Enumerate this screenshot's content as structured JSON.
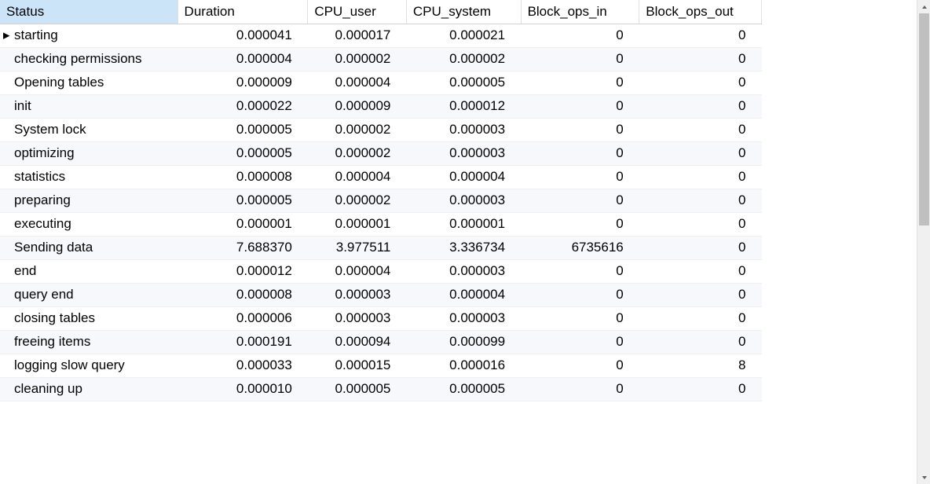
{
  "table": {
    "columns": [
      {
        "key": "status",
        "label": "Status"
      },
      {
        "key": "duration",
        "label": "Duration"
      },
      {
        "key": "cpu_user",
        "label": "CPU_user"
      },
      {
        "key": "cpu_system",
        "label": "CPU_system"
      },
      {
        "key": "block_ops_in",
        "label": "Block_ops_in"
      },
      {
        "key": "block_ops_out",
        "label": "Block_ops_out"
      }
    ],
    "selected_column_index": 0,
    "current_row_index": 0,
    "rows": [
      {
        "status": "starting",
        "duration": "0.000041",
        "cpu_user": "0.000017",
        "cpu_system": "0.000021",
        "block_ops_in": "0",
        "block_ops_out": "0"
      },
      {
        "status": "checking permissions",
        "duration": "0.000004",
        "cpu_user": "0.000002",
        "cpu_system": "0.000002",
        "block_ops_in": "0",
        "block_ops_out": "0"
      },
      {
        "status": "Opening tables",
        "duration": "0.000009",
        "cpu_user": "0.000004",
        "cpu_system": "0.000005",
        "block_ops_in": "0",
        "block_ops_out": "0"
      },
      {
        "status": "init",
        "duration": "0.000022",
        "cpu_user": "0.000009",
        "cpu_system": "0.000012",
        "block_ops_in": "0",
        "block_ops_out": "0"
      },
      {
        "status": "System lock",
        "duration": "0.000005",
        "cpu_user": "0.000002",
        "cpu_system": "0.000003",
        "block_ops_in": "0",
        "block_ops_out": "0"
      },
      {
        "status": "optimizing",
        "duration": "0.000005",
        "cpu_user": "0.000002",
        "cpu_system": "0.000003",
        "block_ops_in": "0",
        "block_ops_out": "0"
      },
      {
        "status": "statistics",
        "duration": "0.000008",
        "cpu_user": "0.000004",
        "cpu_system": "0.000004",
        "block_ops_in": "0",
        "block_ops_out": "0"
      },
      {
        "status": "preparing",
        "duration": "0.000005",
        "cpu_user": "0.000002",
        "cpu_system": "0.000003",
        "block_ops_in": "0",
        "block_ops_out": "0"
      },
      {
        "status": "executing",
        "duration": "0.000001",
        "cpu_user": "0.000001",
        "cpu_system": "0.000001",
        "block_ops_in": "0",
        "block_ops_out": "0"
      },
      {
        "status": "Sending data",
        "duration": "7.688370",
        "cpu_user": "3.977511",
        "cpu_system": "3.336734",
        "block_ops_in": "6735616",
        "block_ops_out": "0"
      },
      {
        "status": "end",
        "duration": "0.000012",
        "cpu_user": "0.000004",
        "cpu_system": "0.000003",
        "block_ops_in": "0",
        "block_ops_out": "0"
      },
      {
        "status": "query end",
        "duration": "0.000008",
        "cpu_user": "0.000003",
        "cpu_system": "0.000004",
        "block_ops_in": "0",
        "block_ops_out": "0"
      },
      {
        "status": "closing tables",
        "duration": "0.000006",
        "cpu_user": "0.000003",
        "cpu_system": "0.000003",
        "block_ops_in": "0",
        "block_ops_out": "0"
      },
      {
        "status": "freeing items",
        "duration": "0.000191",
        "cpu_user": "0.000094",
        "cpu_system": "0.000099",
        "block_ops_in": "0",
        "block_ops_out": "0"
      },
      {
        "status": "logging slow query",
        "duration": "0.000033",
        "cpu_user": "0.000015",
        "cpu_system": "0.000016",
        "block_ops_in": "0",
        "block_ops_out": "8"
      },
      {
        "status": "cleaning up",
        "duration": "0.000010",
        "cpu_user": "0.000005",
        "cpu_system": "0.000005",
        "block_ops_in": "0",
        "block_ops_out": "0"
      }
    ]
  }
}
